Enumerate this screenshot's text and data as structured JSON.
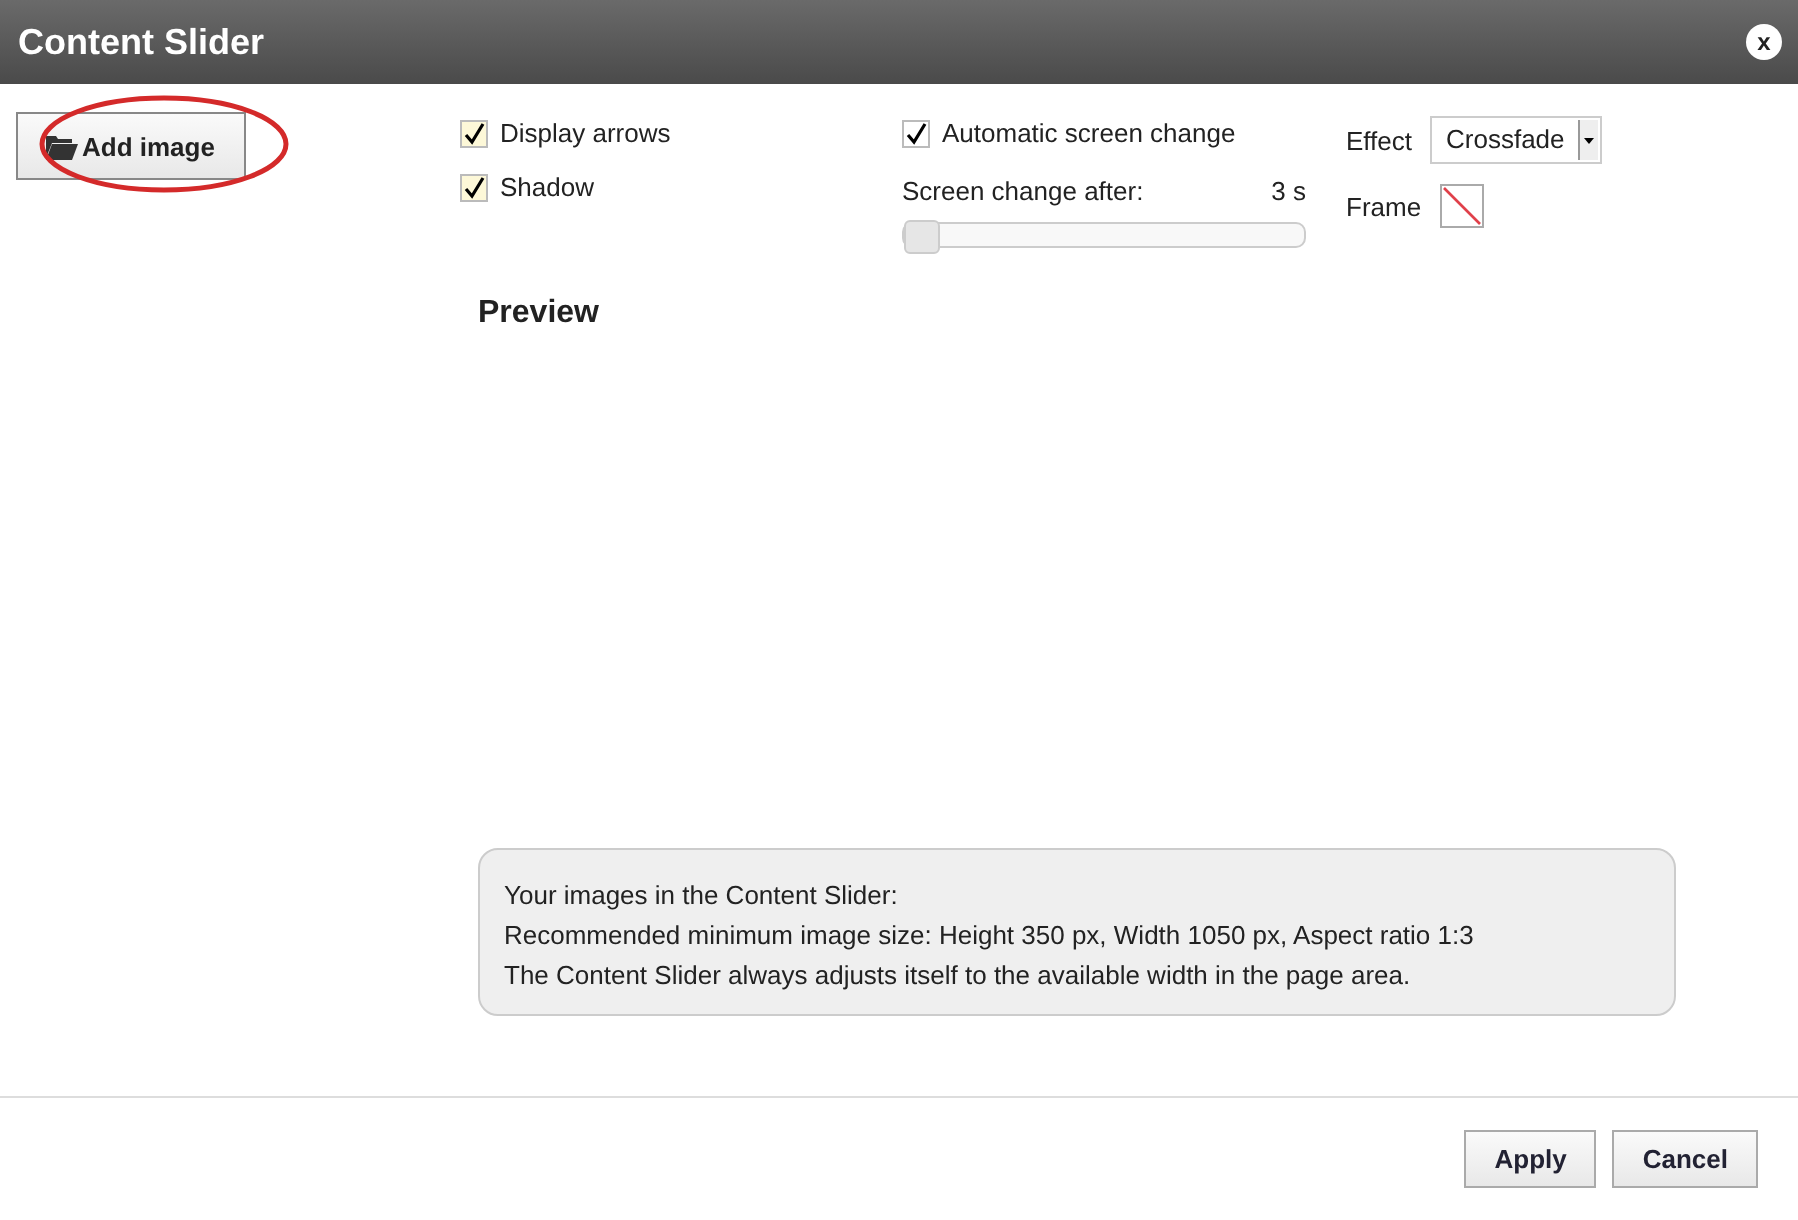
{
  "window": {
    "title": "Content Slider",
    "close": "x"
  },
  "add_button": {
    "label": "Add image",
    "annotated": true
  },
  "options": [
    {
      "label": "Display arrows",
      "checked": true
    },
    {
      "label": "Shadow",
      "checked": true
    }
  ],
  "auto_change": {
    "label": "Automatic screen change",
    "checked": true
  },
  "interval": {
    "label": "Screen change after:",
    "reading": "3 s",
    "level": 0
  },
  "effect": {
    "label": "Effect",
    "value": "Crossfade"
  },
  "frame": {
    "label": "Frame"
  },
  "preview": {
    "title": "Preview"
  },
  "info": [
    "Your images in the Content Slider:",
    "Recommended minimum image size: Height 350 px, Width 1050 px, Aspect ratio 1:3",
    "The Content Slider always adjusts itself to the available width in the page area."
  ],
  "buttons": [
    "Apply",
    "Cancel"
  ]
}
